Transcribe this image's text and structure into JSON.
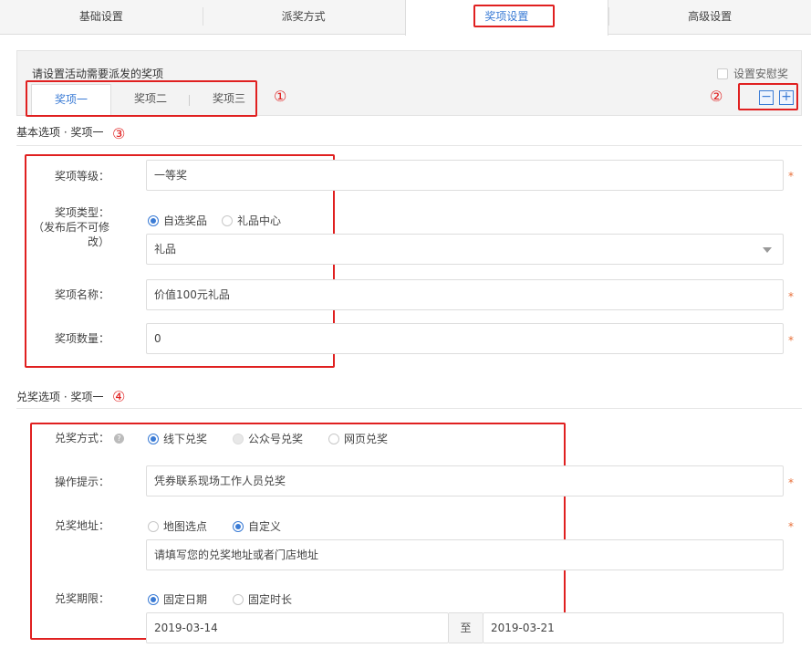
{
  "top_tabs": [
    "基础设置",
    "派奖方式",
    "奖项设置",
    "高级设置"
  ],
  "prize_panel": {
    "title": "请设置活动需要派发的奖项",
    "consolation_label": "设置安慰奖",
    "tabs": [
      "奖项一",
      "奖项二",
      "奖项三"
    ],
    "minus": "−",
    "plus": "+"
  },
  "annotations": [
    "①",
    "②",
    "③",
    "④"
  ],
  "basic": {
    "heading": "基本选项 · 奖项一",
    "level_label": "奖项等级：",
    "level_value": "一等奖",
    "type_label_1": "奖项类型：",
    "type_label_2": "（发布后不可修",
    "type_label_3": "改）",
    "type_options": [
      "自选奖品",
      "礼品中心"
    ],
    "type_select_value": "礼品",
    "name_label": "奖项名称：",
    "name_value": "价值100元礼品",
    "qty_label": "奖项数量：",
    "qty_value": "0",
    "required": "*"
  },
  "redeem": {
    "heading": "兑奖选项 · 奖项一",
    "method_label": "兑奖方式：",
    "help_icon": "?",
    "method_options": [
      "线下兑奖",
      "公众号兑奖",
      "网页兑奖"
    ],
    "tip_label": "操作提示：",
    "tip_value": "凭券联系现场工作人员兑奖",
    "addr_label": "兑奖地址：",
    "addr_options": [
      "地图选点",
      "自定义"
    ],
    "addr_placeholder": "请填写您的兑奖地址或者门店地址",
    "period_label": "兑奖期限：",
    "period_options": [
      "固定日期",
      "固定时长"
    ],
    "start_date": "2019-03-14",
    "to": "至",
    "end_date": "2019-03-21",
    "required": "*"
  }
}
